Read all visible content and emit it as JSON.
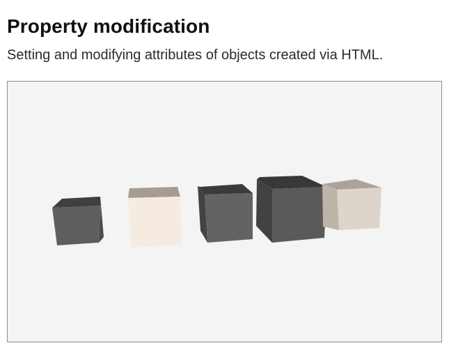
{
  "header": {
    "title": "Property modification",
    "subtitle": "Setting and modifying attributes of objects created via HTML."
  },
  "scene": {
    "background": "#f4f4f4",
    "border_color": "#8c8c8c",
    "objects": [
      {
        "shape": "box",
        "color": "#5e5e5e"
      },
      {
        "shape": "box",
        "color": "#f6ebe1"
      },
      {
        "shape": "box",
        "color": "#636363"
      },
      {
        "shape": "box",
        "color": "#5a5a5a"
      },
      {
        "shape": "box",
        "color": "#ddd4cb"
      }
    ]
  }
}
